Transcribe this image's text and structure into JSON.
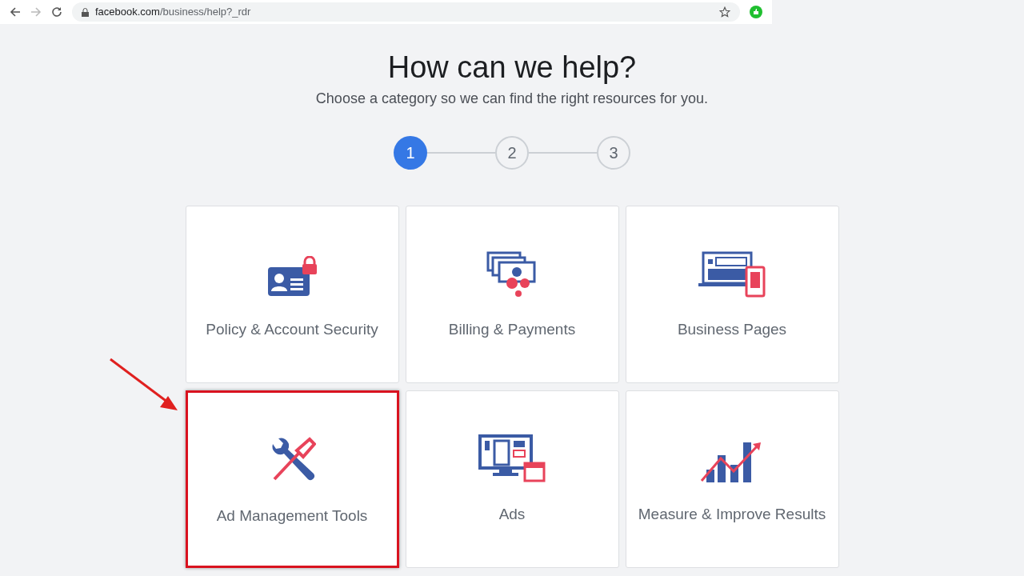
{
  "browser": {
    "url_host": "facebook.com",
    "url_path": "/business/help?_rdr"
  },
  "heading": "How can we help?",
  "subheading": "Choose a category so we can find the right resources for you.",
  "steps": [
    {
      "label": "1",
      "selected": true
    },
    {
      "label": "2",
      "selected": false
    },
    {
      "label": "3",
      "selected": false
    }
  ],
  "categories": [
    {
      "kind": "id-card",
      "label": "Policy & Account Security",
      "highlighted": false
    },
    {
      "kind": "money",
      "label": "Billing & Payments",
      "highlighted": false
    },
    {
      "kind": "devices",
      "label": "Business Pages",
      "highlighted": false
    },
    {
      "kind": "tools",
      "label": "Ad Management Tools",
      "highlighted": true
    },
    {
      "kind": "monitor",
      "label": "Ads",
      "highlighted": false
    },
    {
      "kind": "chart",
      "label": "Measure & Improve Results",
      "highlighted": false
    }
  ]
}
